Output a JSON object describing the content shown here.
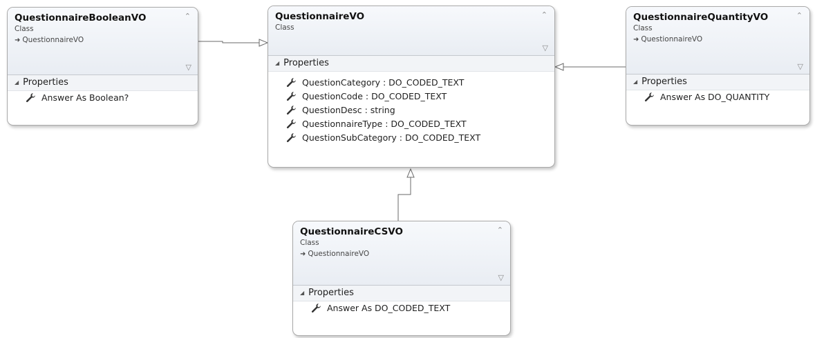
{
  "colors": {
    "border": "#a9a9a9",
    "header": "#eef1f5",
    "line": "#6a6a6a"
  },
  "classes": [
    {
      "name": "QuestionnaireBooleanVO",
      "kind": "Class",
      "base": "QuestionnaireVO",
      "section": "Properties",
      "members": [
        "Answer As Boolean?"
      ]
    },
    {
      "name": "QuestionnaireVO",
      "kind": "Class",
      "section": "Properties",
      "members": [
        "QuestionCategory : DO_CODED_TEXT",
        "QuestionCode : DO_CODED_TEXT",
        "QuestionDesc : string",
        "QuestionnaireType : DO_CODED_TEXT",
        "QuestionSubCategory : DO_CODED_TEXT"
      ]
    },
    {
      "name": "QuestionnaireQuantityVO",
      "kind": "Class",
      "base": "QuestionnaireVO",
      "section": "Properties",
      "members": [
        "Answer As DO_QUANTITY"
      ]
    },
    {
      "name": "QuestionnaireCSVO",
      "kind": "Class",
      "base": "QuestionnaireVO",
      "section": "Properties",
      "members": [
        "Answer As DO_CODED_TEXT"
      ]
    }
  ],
  "inheritance": [
    {
      "from": "QuestionnaireBooleanVO",
      "to": "QuestionnaireVO"
    },
    {
      "from": "QuestionnaireQuantityVO",
      "to": "QuestionnaireVO"
    },
    {
      "from": "QuestionnaireCSVO",
      "to": "QuestionnaireVO"
    }
  ]
}
